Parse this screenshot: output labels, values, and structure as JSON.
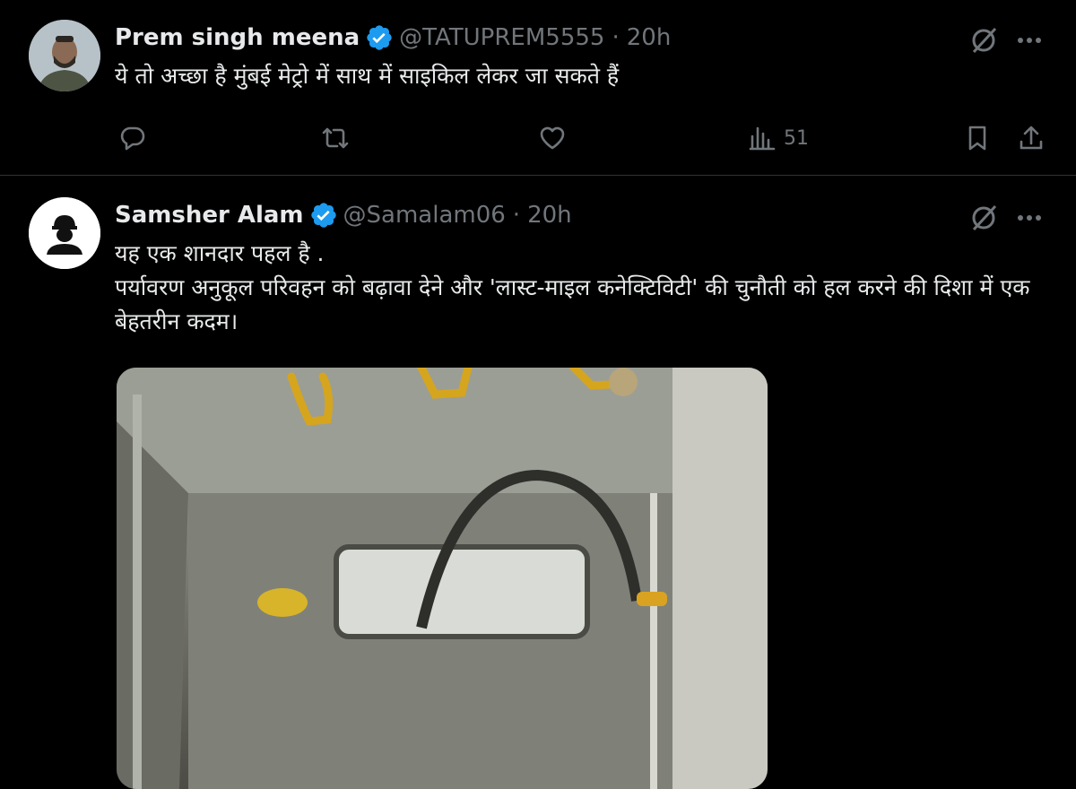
{
  "tweets": [
    {
      "name": "Prem singh meena",
      "handle": "@TATUPREM5555",
      "separator": "·",
      "time": "20h",
      "text": "ये तो अच्छा है मुंबई मेट्रो में साथ में साइकिल लेकर जा सकते हैं",
      "views": "51",
      "icons": [
        "reply-icon",
        "retweet-icon",
        "like-icon",
        "views-icon",
        "bookmark-icon",
        "share-icon",
        "grok-icon",
        "more-icon",
        "verified-icon"
      ]
    },
    {
      "name": "Samsher Alam",
      "handle": "@Samalam06",
      "separator": "·",
      "time": "20h",
      "text_lines": [
        "यह एक शानदार पहल है .",
        "पर्यावरण अनुकूल परिवहन को बढ़ावा देने और 'लास्ट-माइल कनेक्टिविटी' की चुनौती को हल करने की दिशा में एक बेहतरीन कदम।"
      ],
      "media": {
        "type": "photo",
        "subject": "bicycle inside metro train"
      },
      "icons": [
        "grok-icon",
        "more-icon",
        "verified-icon"
      ]
    }
  ],
  "colors": {
    "background": "#000000",
    "text": "#e7e9ea",
    "muted": "#71767b",
    "verified": "#1d9bf0",
    "divider": "#2f3336"
  }
}
